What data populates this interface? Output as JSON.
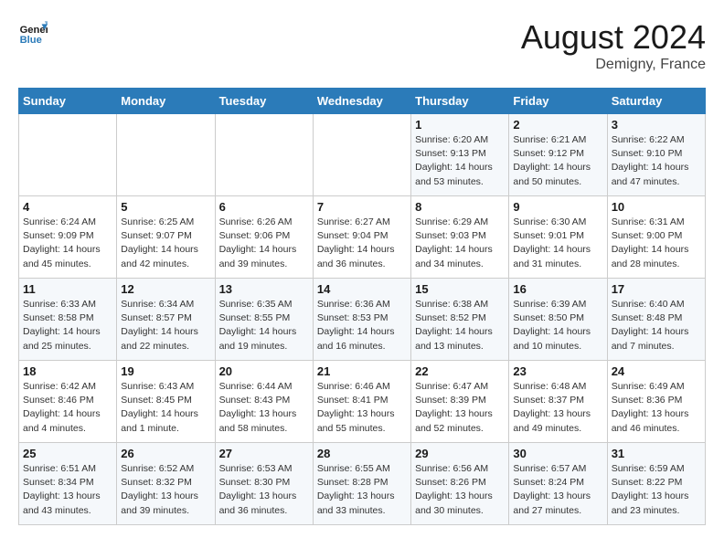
{
  "header": {
    "logo_line1": "General",
    "logo_line2": "Blue",
    "month_year": "August 2024",
    "location": "Demigny, France"
  },
  "days_of_week": [
    "Sunday",
    "Monday",
    "Tuesday",
    "Wednesday",
    "Thursday",
    "Friday",
    "Saturday"
  ],
  "weeks": [
    [
      {
        "day": "",
        "info": ""
      },
      {
        "day": "",
        "info": ""
      },
      {
        "day": "",
        "info": ""
      },
      {
        "day": "",
        "info": ""
      },
      {
        "day": "1",
        "info": "Sunrise: 6:20 AM\nSunset: 9:13 PM\nDaylight: 14 hours\nand 53 minutes."
      },
      {
        "day": "2",
        "info": "Sunrise: 6:21 AM\nSunset: 9:12 PM\nDaylight: 14 hours\nand 50 minutes."
      },
      {
        "day": "3",
        "info": "Sunrise: 6:22 AM\nSunset: 9:10 PM\nDaylight: 14 hours\nand 47 minutes."
      }
    ],
    [
      {
        "day": "4",
        "info": "Sunrise: 6:24 AM\nSunset: 9:09 PM\nDaylight: 14 hours\nand 45 minutes."
      },
      {
        "day": "5",
        "info": "Sunrise: 6:25 AM\nSunset: 9:07 PM\nDaylight: 14 hours\nand 42 minutes."
      },
      {
        "day": "6",
        "info": "Sunrise: 6:26 AM\nSunset: 9:06 PM\nDaylight: 14 hours\nand 39 minutes."
      },
      {
        "day": "7",
        "info": "Sunrise: 6:27 AM\nSunset: 9:04 PM\nDaylight: 14 hours\nand 36 minutes."
      },
      {
        "day": "8",
        "info": "Sunrise: 6:29 AM\nSunset: 9:03 PM\nDaylight: 14 hours\nand 34 minutes."
      },
      {
        "day": "9",
        "info": "Sunrise: 6:30 AM\nSunset: 9:01 PM\nDaylight: 14 hours\nand 31 minutes."
      },
      {
        "day": "10",
        "info": "Sunrise: 6:31 AM\nSunset: 9:00 PM\nDaylight: 14 hours\nand 28 minutes."
      }
    ],
    [
      {
        "day": "11",
        "info": "Sunrise: 6:33 AM\nSunset: 8:58 PM\nDaylight: 14 hours\nand 25 minutes."
      },
      {
        "day": "12",
        "info": "Sunrise: 6:34 AM\nSunset: 8:57 PM\nDaylight: 14 hours\nand 22 minutes."
      },
      {
        "day": "13",
        "info": "Sunrise: 6:35 AM\nSunset: 8:55 PM\nDaylight: 14 hours\nand 19 minutes."
      },
      {
        "day": "14",
        "info": "Sunrise: 6:36 AM\nSunset: 8:53 PM\nDaylight: 14 hours\nand 16 minutes."
      },
      {
        "day": "15",
        "info": "Sunrise: 6:38 AM\nSunset: 8:52 PM\nDaylight: 14 hours\nand 13 minutes."
      },
      {
        "day": "16",
        "info": "Sunrise: 6:39 AM\nSunset: 8:50 PM\nDaylight: 14 hours\nand 10 minutes."
      },
      {
        "day": "17",
        "info": "Sunrise: 6:40 AM\nSunset: 8:48 PM\nDaylight: 14 hours\nand 7 minutes."
      }
    ],
    [
      {
        "day": "18",
        "info": "Sunrise: 6:42 AM\nSunset: 8:46 PM\nDaylight: 14 hours\nand 4 minutes."
      },
      {
        "day": "19",
        "info": "Sunrise: 6:43 AM\nSunset: 8:45 PM\nDaylight: 14 hours\nand 1 minute."
      },
      {
        "day": "20",
        "info": "Sunrise: 6:44 AM\nSunset: 8:43 PM\nDaylight: 13 hours\nand 58 minutes."
      },
      {
        "day": "21",
        "info": "Sunrise: 6:46 AM\nSunset: 8:41 PM\nDaylight: 13 hours\nand 55 minutes."
      },
      {
        "day": "22",
        "info": "Sunrise: 6:47 AM\nSunset: 8:39 PM\nDaylight: 13 hours\nand 52 minutes."
      },
      {
        "day": "23",
        "info": "Sunrise: 6:48 AM\nSunset: 8:37 PM\nDaylight: 13 hours\nand 49 minutes."
      },
      {
        "day": "24",
        "info": "Sunrise: 6:49 AM\nSunset: 8:36 PM\nDaylight: 13 hours\nand 46 minutes."
      }
    ],
    [
      {
        "day": "25",
        "info": "Sunrise: 6:51 AM\nSunset: 8:34 PM\nDaylight: 13 hours\nand 43 minutes."
      },
      {
        "day": "26",
        "info": "Sunrise: 6:52 AM\nSunset: 8:32 PM\nDaylight: 13 hours\nand 39 minutes."
      },
      {
        "day": "27",
        "info": "Sunrise: 6:53 AM\nSunset: 8:30 PM\nDaylight: 13 hours\nand 36 minutes."
      },
      {
        "day": "28",
        "info": "Sunrise: 6:55 AM\nSunset: 8:28 PM\nDaylight: 13 hours\nand 33 minutes."
      },
      {
        "day": "29",
        "info": "Sunrise: 6:56 AM\nSunset: 8:26 PM\nDaylight: 13 hours\nand 30 minutes."
      },
      {
        "day": "30",
        "info": "Sunrise: 6:57 AM\nSunset: 8:24 PM\nDaylight: 13 hours\nand 27 minutes."
      },
      {
        "day": "31",
        "info": "Sunrise: 6:59 AM\nSunset: 8:22 PM\nDaylight: 13 hours\nand 23 minutes."
      }
    ]
  ]
}
